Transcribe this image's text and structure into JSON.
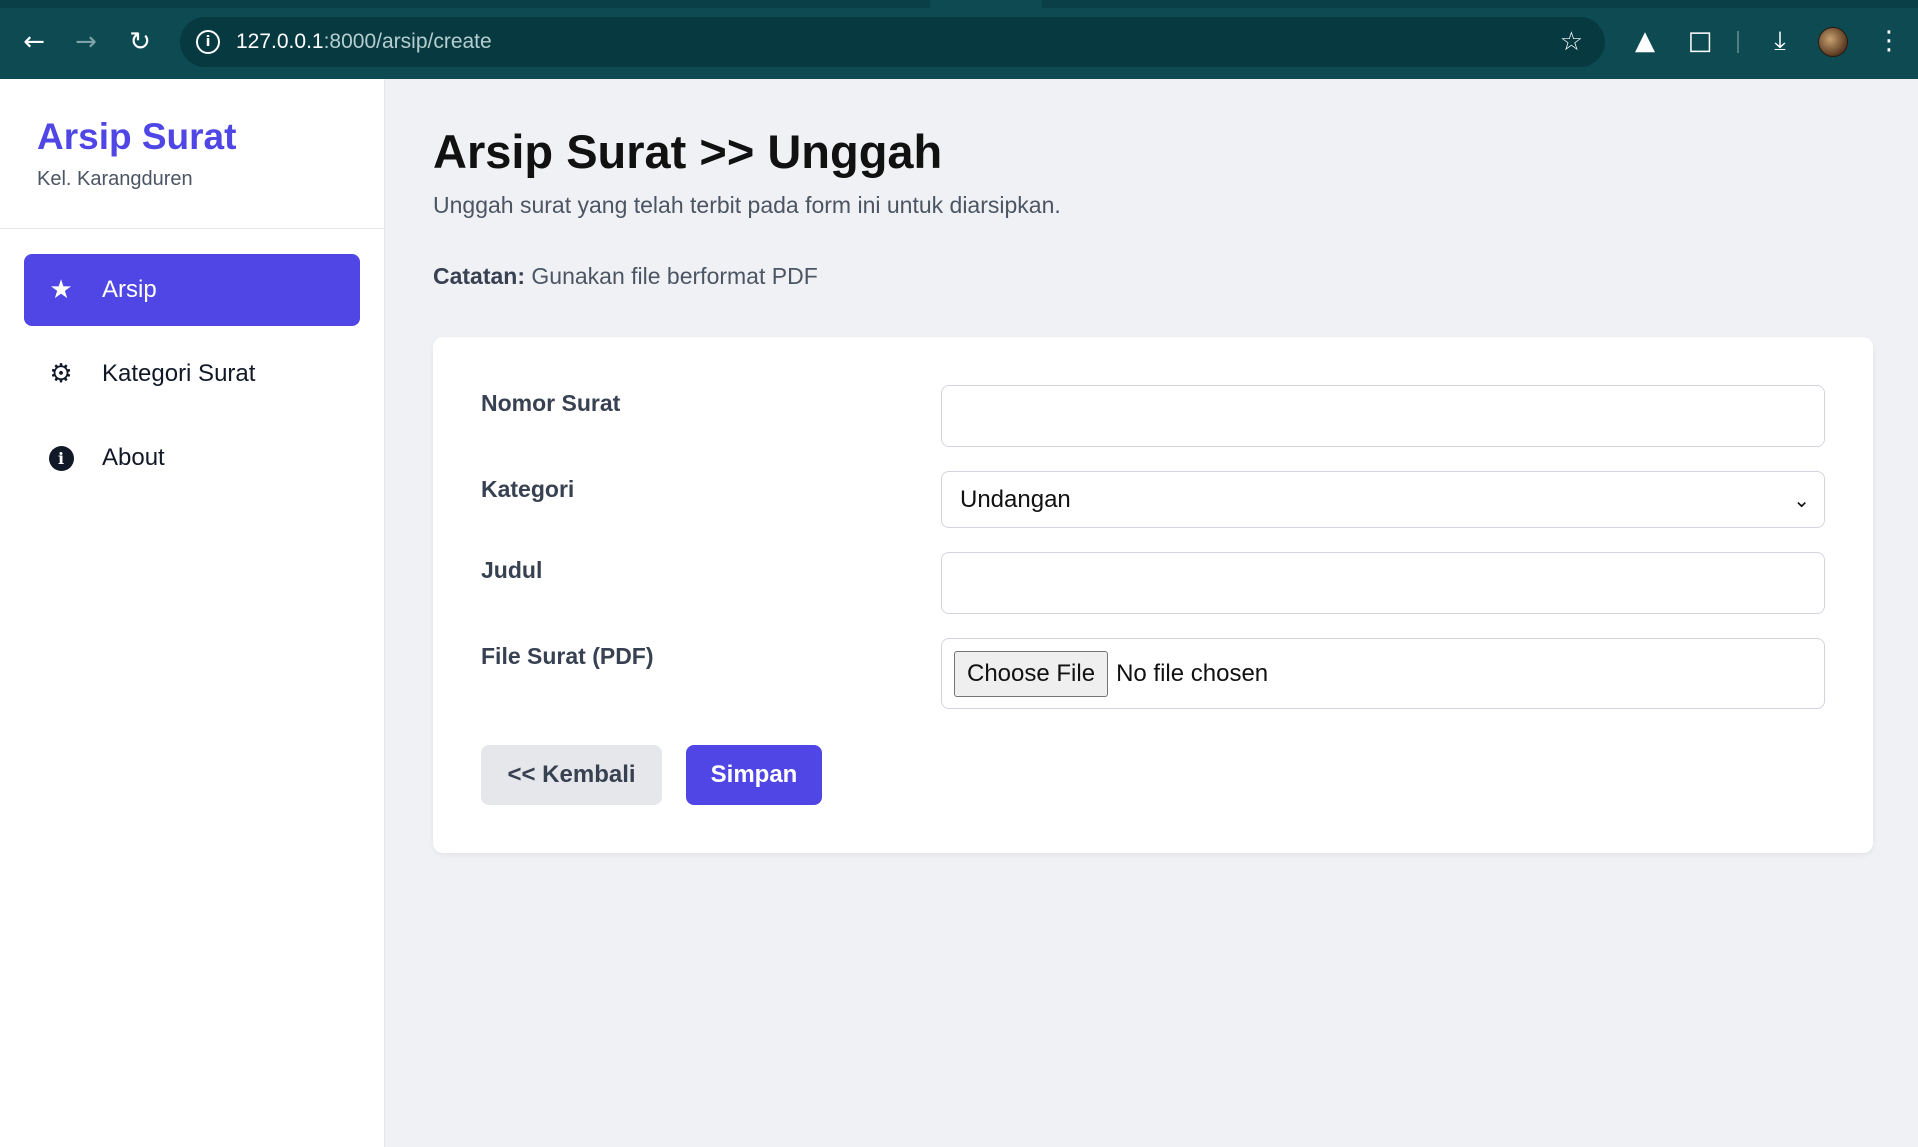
{
  "browser": {
    "url_host": "127.0.0.1",
    "url_path": ":8000/arsip/create",
    "icons": [
      "back-icon",
      "forward-icon",
      "reload-icon",
      "site-info-icon",
      "bookmark-star-icon",
      "extension-triangle-icon",
      "extensions-puzzle-icon",
      "download-icon",
      "profile-avatar",
      "menu-dots-icon"
    ]
  },
  "sidebar": {
    "brand_title": "Arsip Surat",
    "brand_subtitle": "Kel. Karangduren",
    "items": [
      {
        "label": "Arsip",
        "icon": "star-icon",
        "active": true
      },
      {
        "label": "Kategori Surat",
        "icon": "gear-icon",
        "active": false
      },
      {
        "label": "About",
        "icon": "info-icon",
        "active": false
      }
    ]
  },
  "main": {
    "title": "Arsip Surat >> Unggah",
    "description": "Unggah surat yang telah terbit pada form ini untuk diarsipkan.",
    "note_label": "Catatan:",
    "note_text": "Gunakan file berformat PDF"
  },
  "form": {
    "nomor_label": "Nomor Surat",
    "nomor_value": "",
    "kategori_label": "Kategori",
    "kategori_value": "Undangan",
    "judul_label": "Judul",
    "judul_value": "",
    "file_label": "File Surat (PDF)",
    "file_button": "Choose File",
    "file_status": "No file chosen",
    "back_button": "<< Kembali",
    "save_button": "Simpan"
  },
  "colors": {
    "accent": "#4f46e5",
    "chrome": "#0d4a52",
    "background": "#f0f1f4"
  }
}
